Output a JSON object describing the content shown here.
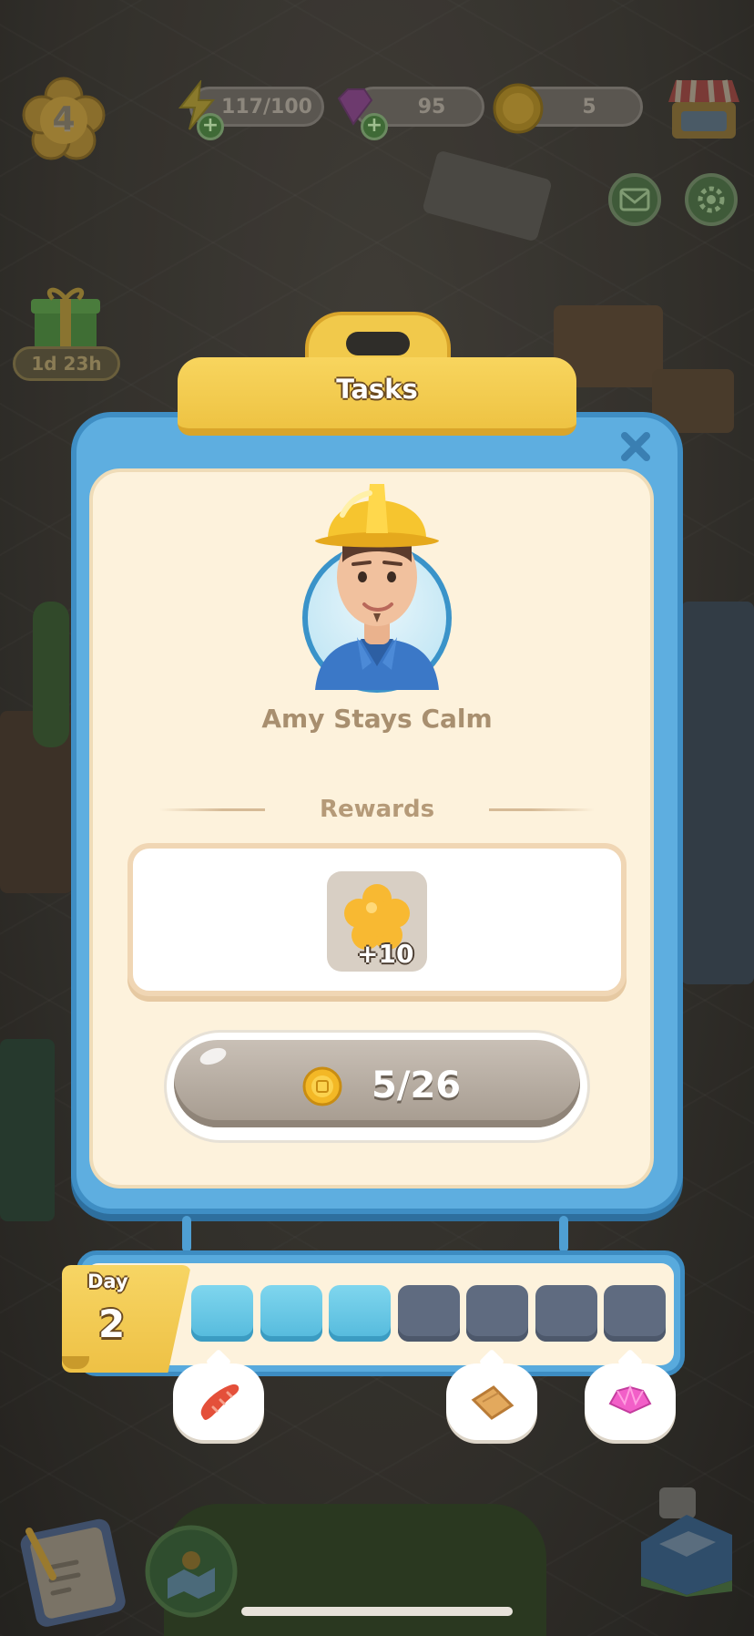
{
  "hud": {
    "level": "4",
    "energy": "117/100",
    "gems": "95",
    "coins": "5",
    "gift_timer": "1d 23h"
  },
  "icons": {
    "level_badge": "clover-badge-icon",
    "energy": "lightning-icon",
    "gems": "gem-icon",
    "coins": "coin-icon",
    "shop": "shop-icon",
    "mail": "mail-icon",
    "settings": "gear-icon",
    "gift": "gift-icon",
    "close": "close-icon",
    "reward": "clover-icon",
    "milestone_1": "sausage-icon",
    "milestone_2": "wood-plank-icon",
    "milestone_3": "pink-gem-icon",
    "bottom_left": "task-notebook-icon",
    "bottom_mid": "map-icon",
    "bottom_right": "cash-register-icon"
  },
  "dialog": {
    "title": "Tasks",
    "character_name": "Amy Stays Calm",
    "rewards_label": "Rewards",
    "reward_amount": "+10",
    "button_label": "5/26"
  },
  "day_progress": {
    "day_word": "Day",
    "day_number": "2",
    "cells_total": 7,
    "cells_filled": 3
  },
  "colors": {
    "card_blue": "#5eaee0",
    "card_cream": "#fdf2dc",
    "header_gold": "#f1c94b",
    "filled_cell": "#5fc2e2",
    "empty_cell": "#5f6b80"
  }
}
